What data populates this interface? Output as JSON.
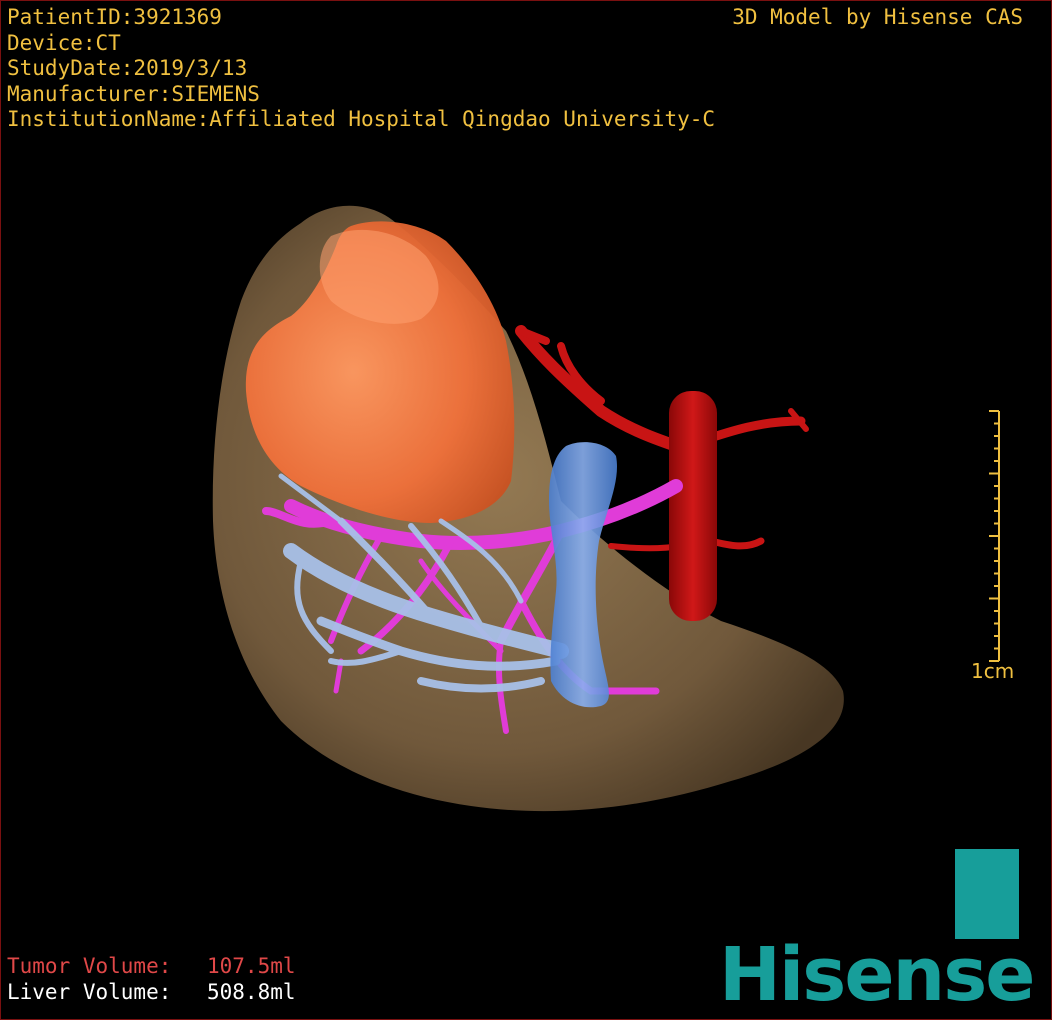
{
  "header": {
    "patient_id": "PatientID:3921369",
    "device": "Device:CT",
    "study_date": "StudyDate:2019/3/13",
    "manufacturer": "Manufacturer:SIEMENS",
    "institution": "InstitutionName:Affiliated Hospital Qingdao University-C"
  },
  "credit": "3D Model by Hisense CAS",
  "scale_bar": {
    "label": "1cm"
  },
  "volumes": {
    "tumor_label": "Tumor Volume:",
    "tumor_value": "107.5ml",
    "liver_label": "Liver Volume:",
    "liver_value": "508.8ml"
  },
  "logo": {
    "wordmark": "Hisense"
  },
  "colors": {
    "overlay_text": "#f0c040",
    "tumor_text": "#e04848",
    "liver_tissue": "#8a6e48",
    "tumor": "#f06a30",
    "hepatic_artery": "#c01010",
    "portal_vein": "#e040d0",
    "hepatic_vein": "#a8c0e8",
    "ivc": "#5a8ee0",
    "brand": "#179e9a"
  }
}
